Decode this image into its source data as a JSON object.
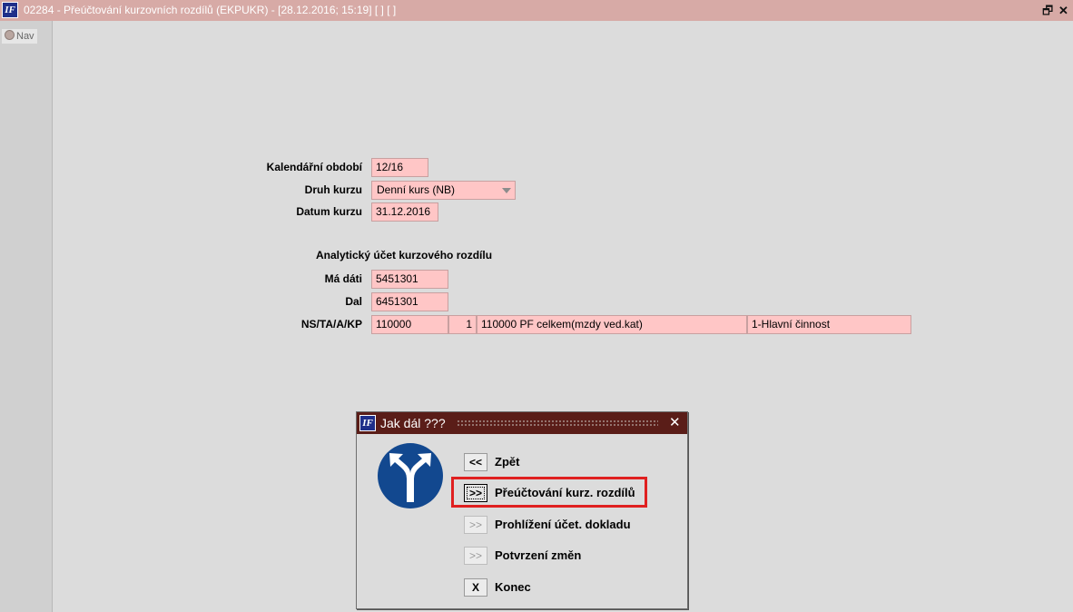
{
  "window": {
    "logo": "IF",
    "title": "02284 - Přeúčtování kurzovních rozdílů (EKPUKR) - [28.12.2016; 15:19]  [ ]  [ ]",
    "restore_icon": "restore-icon",
    "close_icon": "close-icon"
  },
  "nav": {
    "tab_label": "Nav"
  },
  "form": {
    "period": {
      "label": "Kalendářní období",
      "value": "12/16"
    },
    "rate_type": {
      "label": "Druh kurzu",
      "value": "Denní kurs (NB)"
    },
    "rate_date": {
      "label": "Datum kurzu",
      "value": "31.12.2016"
    },
    "section_title": "Analytický účet kurzového rozdílu",
    "debit": {
      "label": "Má dáti",
      "value": "5451301"
    },
    "credit": {
      "label": "Dal",
      "value": "6451301"
    },
    "ns": {
      "label": "NS/TA/A/KP",
      "ns_value": "110000",
      "ta_value": "1",
      "a_value": "110000 PF celkem(mzdy ved.kat)",
      "kp_value": "1-Hlavní činnost"
    }
  },
  "dialog": {
    "logo": "IF",
    "title": "Jak dál ???",
    "close_symbol": "✕",
    "icon": "split-arrow-sign-icon",
    "highlight_color": "#e02020",
    "options": [
      {
        "button": "<<",
        "label": "Zpět",
        "enabled": true
      },
      {
        "button": ">>",
        "label": "Přeúčtování kurz. rozdílů",
        "enabled": true,
        "focused": true
      },
      {
        "button": ">>",
        "label": "Prohlížení účet. dokladu",
        "enabled": false
      },
      {
        "button": ">>",
        "label": "Potvrzení změn",
        "enabled": false
      },
      {
        "button": "X",
        "label": "Konec",
        "enabled": true
      }
    ]
  }
}
